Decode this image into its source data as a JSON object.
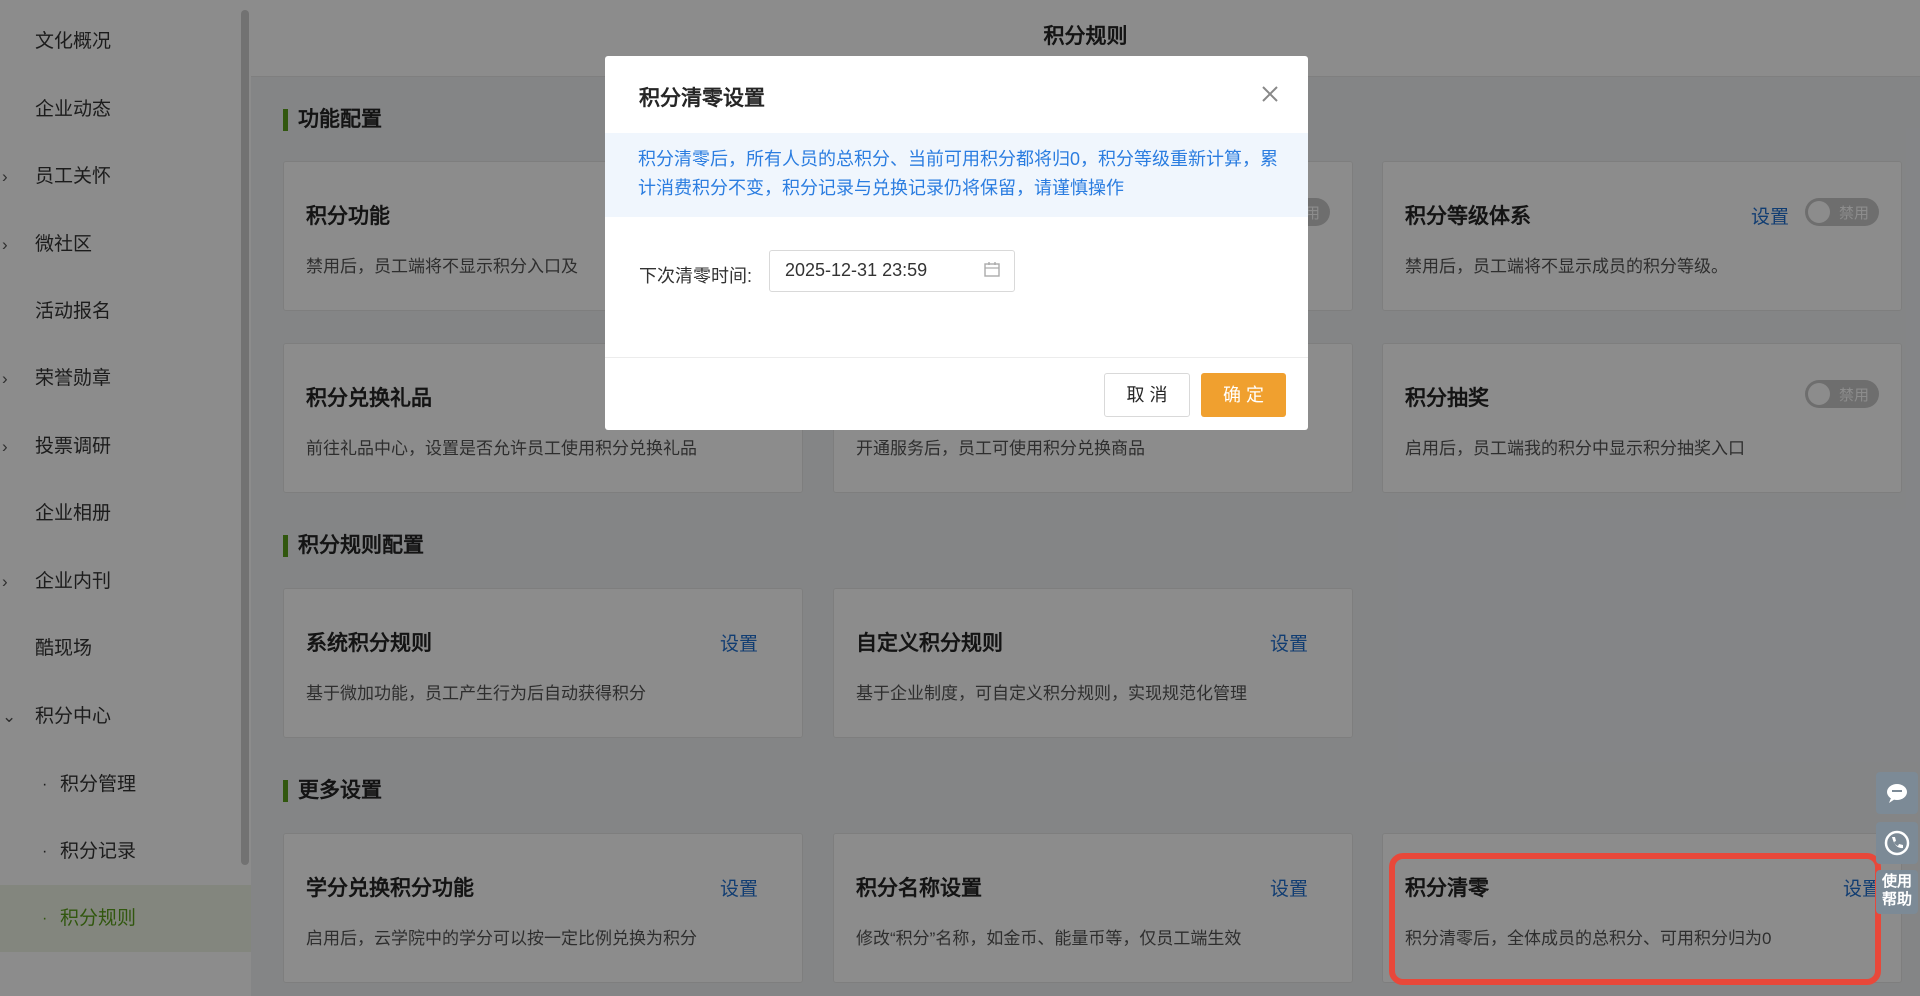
{
  "sidebar": {
    "items": [
      {
        "label": "文化概况",
        "arrow": ""
      },
      {
        "label": "企业动态",
        "arrow": ""
      },
      {
        "label": "员工关怀",
        "arrow": "›"
      },
      {
        "label": "微社区",
        "arrow": "›"
      },
      {
        "label": "活动报名",
        "arrow": ""
      },
      {
        "label": "荣誉勋章",
        "arrow": "›"
      },
      {
        "label": "投票调研",
        "arrow": "›"
      },
      {
        "label": "企业相册",
        "arrow": ""
      },
      {
        "label": "企业内刊",
        "arrow": "›"
      },
      {
        "label": "酷现场",
        "arrow": ""
      },
      {
        "label": "积分中心",
        "arrow": "⌄"
      }
    ],
    "sub_items": [
      {
        "label": "积分管理",
        "dot": "·"
      },
      {
        "label": "积分记录",
        "dot": "·"
      },
      {
        "label": "积分规则",
        "dot": "·"
      }
    ]
  },
  "page": {
    "title": "积分规则"
  },
  "sections": {
    "function": "功能配置",
    "rules": "积分规则配置",
    "more": "更多设置"
  },
  "cards": {
    "points_function": {
      "title": "积分功能",
      "desc": "禁用后，员工端将不显示积分入口及"
    },
    "points_level": {
      "title": "积分等级体系",
      "desc": "禁用后，员工端将不显示成员的积分等级。",
      "set": "设置",
      "toggle": "禁用"
    },
    "exchange_gifts": {
      "title": "积分兑换礼品",
      "desc": "前往礼品中心，设置是否允许员工使用积分兑换礼品"
    },
    "exchange_service": {
      "desc": "开通服务后，员工可使用积分兑换商品"
    },
    "lottery": {
      "title": "积分抽奖",
      "desc": "启用后，员工端我的积分中显示积分抽奖入口",
      "toggle": "禁用"
    },
    "system_rules": {
      "title": "系统积分规则",
      "desc": "基于微加功能，员工产生行为后自动获得积分",
      "set": "设置"
    },
    "custom_rules": {
      "title": "自定义积分规则",
      "desc": "基于企业制度，可自定义积分规则，实现规范化管理",
      "set": "设置"
    },
    "credit_exchange": {
      "title": "学分兑换积分功能",
      "desc": "启用后，云学院中的学分可以按一定比例兑换为积分",
      "set": "设置"
    },
    "name_setting": {
      "title": "积分名称设置",
      "desc": "修改“积分”名称，如金币、能量币等，仅员工端生效",
      "set": "设置"
    },
    "reset": {
      "title": "积分清零",
      "desc": "积分清零后，全体成员的总积分、可用积分归为0",
      "set": "设置"
    }
  },
  "hidden_toggle": {
    "label": "用"
  },
  "float_buttons": {
    "help": "使用帮助"
  },
  "modal": {
    "title": "积分清零设置",
    "alert": "积分清零后，所有人员的总积分、当前可用积分都将归0，积分等级重新计算，累计消费积分不变，积分记录与兑换记录仍将保留，请谨慎操作",
    "field_label": "下次清零时间:",
    "date_value": "2025-12-31 23:59",
    "cancel": "取 消",
    "ok": "确 定"
  },
  "colors": {
    "accent": "#5a9e1a",
    "link": "#1f6fcf",
    "primary_button": "#f0a02f",
    "highlight": "#e8483a"
  }
}
